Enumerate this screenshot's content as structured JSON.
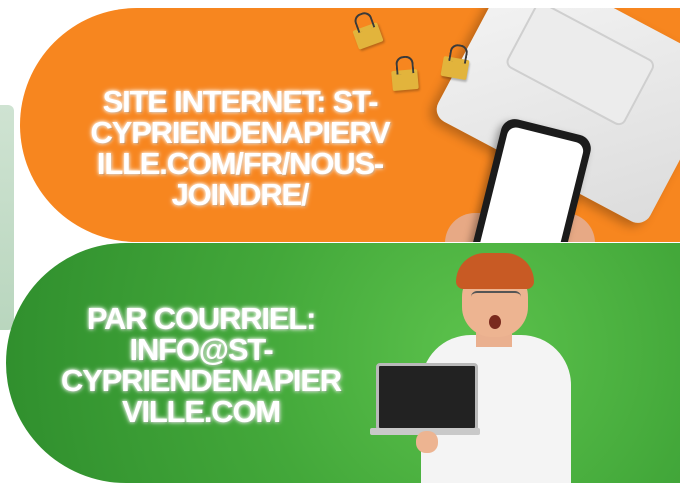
{
  "cards": [
    {
      "lines": [
        "SITE INTERNET: ST-",
        "CYPRIENDENAPIERV",
        "ILLE.COM/FR/NOUS-",
        "JOINDRE/"
      ],
      "background_color": "#f7861f"
    },
    {
      "lines": [
        "PAR COURRIEL:",
        "INFO@ST-",
        "CYPRIENDENAPIER",
        "VILLE.COM"
      ],
      "background_color": "#43a83a"
    }
  ],
  "icons": [
    "laptop-icon",
    "smartphone-icon",
    "paperclip-icon",
    "person-with-laptop-icon"
  ]
}
